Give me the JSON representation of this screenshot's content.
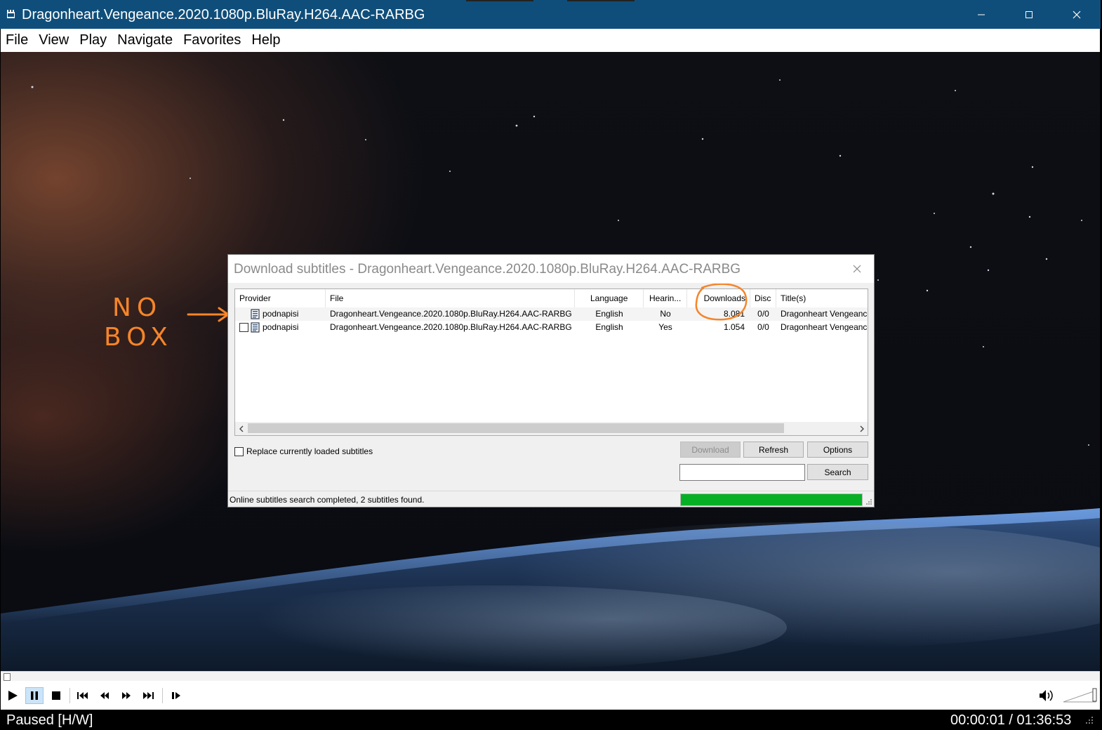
{
  "window": {
    "title": "Dragonheart.Vengeance.2020.1080p.BluRay.H264.AAC-RARBG"
  },
  "menu": {
    "items": [
      "File",
      "View",
      "Play",
      "Navigate",
      "Favorites",
      "Help"
    ]
  },
  "dialog": {
    "title": "Download subtitles - Dragonheart.Vengeance.2020.1080p.BluRay.H264.AAC-RARBG",
    "columns": [
      "Provider",
      "File",
      "Language",
      "Hearin...",
      "Downloads",
      "Disc",
      "Title(s)"
    ],
    "rows": [
      {
        "checkbox_visible": false,
        "provider": "podnapisi",
        "file": "Dragonheart.Vengeance.2020.1080p.BluRay.H264.AAC-RARBG",
        "language": "English",
        "hearing": "No",
        "downloads": "8.081",
        "disc": "0/0",
        "titles": "Dragonheart Vengeance"
      },
      {
        "checkbox_visible": true,
        "provider": "podnapisi",
        "file": "Dragonheart.Vengeance.2020.1080p.BluRay.H264.AAC-RARBG",
        "language": "English",
        "hearing": "Yes",
        "downloads": "1.054",
        "disc": "0/0",
        "titles": "Dragonheart Vengeance"
      }
    ],
    "replace_label": "Replace currently loaded subtitles",
    "replace_checked": false,
    "buttons": {
      "download": "Download",
      "refresh": "Refresh",
      "options": "Options",
      "search": "Search"
    },
    "search_value": "",
    "status_text": "Online subtitles search completed, 2 subtitles found.",
    "progress_percent": 100,
    "progress_color": "#06b025"
  },
  "annotation": {
    "line1": "NO",
    "line2": "BOX",
    "color": "#f5852a"
  },
  "player": {
    "status_left": "Paused [H/W]",
    "status_right": "00:00:01 / 01:36:53",
    "seek_position_fraction": 0.0002,
    "pause_active": true
  },
  "icons": {
    "app": "mpc-film-icon",
    "minimize": "minimize-icon",
    "maximize": "maximize-icon",
    "close": "close-icon",
    "subtitle_file": "document-icon",
    "play": "play-icon",
    "pause": "pause-icon",
    "stop": "stop-icon",
    "prev": "skip-previous-icon",
    "rewind": "rewind-icon",
    "forward": "fast-forward-icon",
    "next": "skip-next-icon",
    "frame_step": "frame-step-icon",
    "volume": "speaker-icon"
  }
}
